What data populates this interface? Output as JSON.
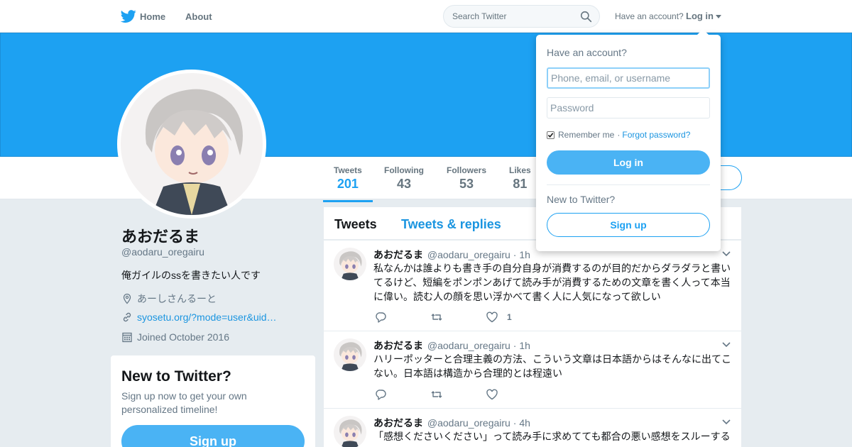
{
  "colors": {
    "brand": "#1da1f2",
    "link": "#1b95e0",
    "button": "#4ab3f4",
    "background": "#e6ecf0"
  },
  "nav": {
    "home_label": "Home",
    "about_label": "About",
    "search_placeholder": "Search Twitter",
    "have_account": "Have an account?",
    "login_label": "Log in",
    "icons": {
      "logo": "twitter-bird-icon",
      "search": "search-icon",
      "caret": "caret-down-icon"
    }
  },
  "profile": {
    "name": "あおだるま",
    "handle": "@aodaru_oregairu",
    "bio": "俺ガイルのssを書きたい人です",
    "location": "あーしさんるーと",
    "url": "syosetu.org/?mode=user&uid…",
    "joined": "Joined October 2016"
  },
  "stats": [
    {
      "label": "Tweets",
      "value": "201"
    },
    {
      "label": "Following",
      "value": "43"
    },
    {
      "label": "Followers",
      "value": "53"
    },
    {
      "label": "Likes",
      "value": "81"
    }
  ],
  "new_to_twitter": {
    "title": "New to Twitter?",
    "text": "Sign up now to get your own personalized timeline!",
    "signup_label": "Sign up"
  },
  "timeline": {
    "tabs": [
      "Tweets",
      "Tweets & replies"
    ],
    "tweets": [
      {
        "name": "あおだるま",
        "handle": "@aodaru_oregairu",
        "dot": "·",
        "time": "1h",
        "text": "私なんかは誰よりも書き手の自分自身が消費するのが目的だからダラダラと書いてるけど、短編をポンポンあげて読み手が消費するための文章を書く人って本当に偉い。読む人の顔を思い浮かべて書く人に人気になって欲しい",
        "likes": "1"
      },
      {
        "name": "あおだるま",
        "handle": "@aodaru_oregairu",
        "dot": "·",
        "time": "1h",
        "text": "ハリーポッターと合理主義の方法、こういう文章は日本語からはそんなに出てこない。日本語は構造から合理的とは程遠い",
        "likes": ""
      },
      {
        "name": "あおだるま",
        "handle": "@aodaru_oregairu",
        "dot": "·",
        "time": "4h",
        "text": "「感想くださいください」って読み手に求めてても都合の悪い感想をスルーする",
        "likes": ""
      }
    ]
  },
  "login_dropdown": {
    "title": "Have an account?",
    "username_placeholder": "Phone, email, or username",
    "password_placeholder": "Password",
    "remember_label": "Remember me",
    "separator": "·",
    "forgot_label": "Forgot password?",
    "login_label": "Log in",
    "new_label": "New to Twitter?",
    "signup_label": "Sign up"
  }
}
